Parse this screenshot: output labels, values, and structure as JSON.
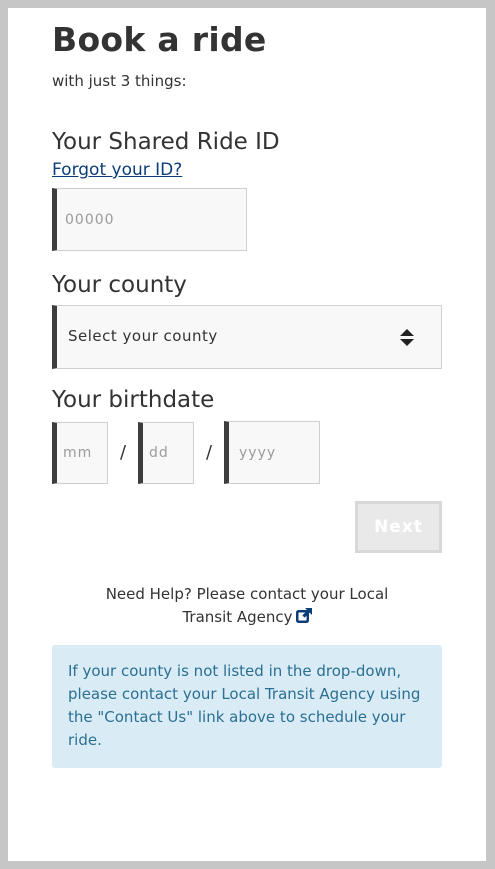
{
  "header": {
    "title": "Book a ride",
    "subtitle": "with just 3 things:"
  },
  "ride_id": {
    "label": "Your Shared Ride ID",
    "forgot_link": "Forgot your ID?",
    "placeholder": "00000"
  },
  "county": {
    "label": "Your county",
    "selected": "Select your county"
  },
  "birthdate": {
    "label": "Your birthdate",
    "month_placeholder": "mm",
    "day_placeholder": "dd",
    "year_placeholder": "yyyy",
    "separator": "/"
  },
  "actions": {
    "next_label": "Next"
  },
  "help": {
    "text": "Need Help? Please contact your Local",
    "link_text": "Transit Agency",
    "link_icon": "external-link-icon"
  },
  "info": {
    "text": "If your county is not listed in the drop-down, please contact your Local Transit Agency using the \"Contact Us\" link above to schedule your ride."
  },
  "colors": {
    "link": "#0b3d7a",
    "info_bg": "#d9ecf5",
    "info_text": "#2b6f92",
    "input_accent": "#3d3d3d"
  }
}
